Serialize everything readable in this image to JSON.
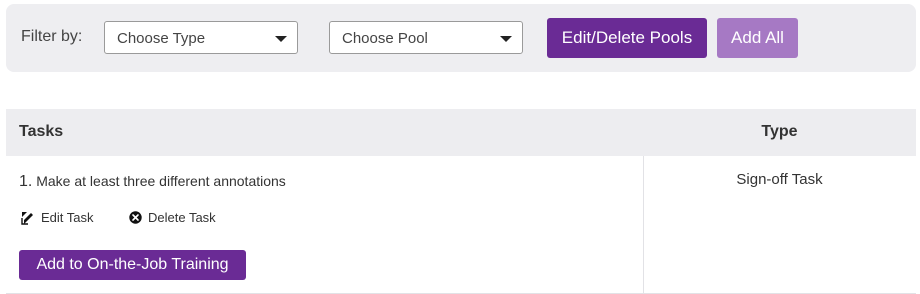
{
  "filter": {
    "label": "Filter by:",
    "type_select": {
      "value": "Choose Type"
    },
    "pool_select": {
      "value": "Choose Pool"
    },
    "edit_pools_label": "Edit/Delete Pools",
    "add_all_label": "Add All"
  },
  "table": {
    "headers": {
      "tasks": "Tasks",
      "type": "Type"
    },
    "rows": [
      {
        "number": "1.",
        "title": "Make at least three different annotations",
        "edit_label": "Edit Task",
        "delete_label": "Delete Task",
        "add_label": "Add to On-the-Job Training",
        "type": "Sign-off Task"
      }
    ]
  },
  "colors": {
    "primary": "#6a2b95",
    "primary_light": "#a679c4",
    "bar_bg": "#eeeef1",
    "header_bg": "#ededf0"
  },
  "icons": [
    "chevron-down-icon",
    "edit-icon",
    "delete-icon"
  ]
}
